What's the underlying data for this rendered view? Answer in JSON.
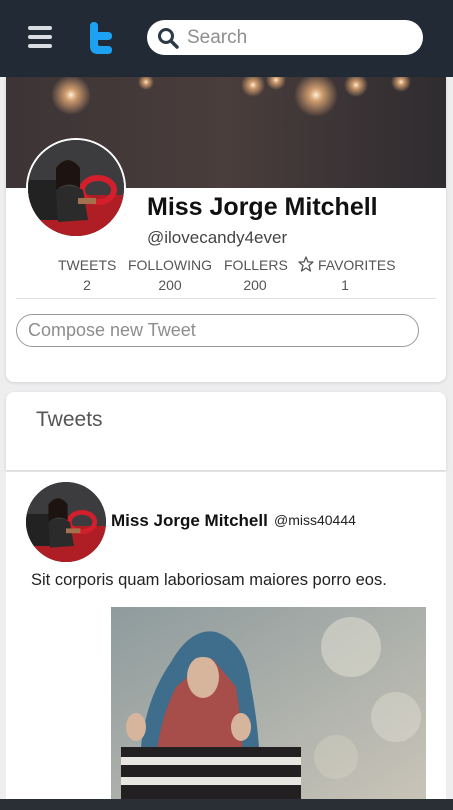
{
  "header": {
    "search": {
      "placeholder": "Search",
      "value": ""
    },
    "menu_icon": "hamburger-menu-icon",
    "logo_icon": "twitter-bird-icon"
  },
  "profile": {
    "name": "Miss Jorge Mitchell",
    "handle": "@ilovecandy4ever",
    "stats": [
      {
        "label": "TWEETS",
        "value": "2"
      },
      {
        "label": "FOLLOWING",
        "value": "200"
      },
      {
        "label": "FOLLERS",
        "value": "200"
      },
      {
        "label": "FAVORITES",
        "value": "1",
        "icon": "star-icon"
      }
    ],
    "compose_placeholder": "Compose new Tweet"
  },
  "tweets_section": {
    "title": "Tweets"
  },
  "tweet": {
    "name": "Miss Jorge Mitchell",
    "handle": "@miss40444",
    "text": "Sit corporis quam laboriosam maiores porro eos."
  },
  "colors": {
    "topbar": "#222b35",
    "accent": "#1da1f2",
    "background": "#eeeeef"
  }
}
